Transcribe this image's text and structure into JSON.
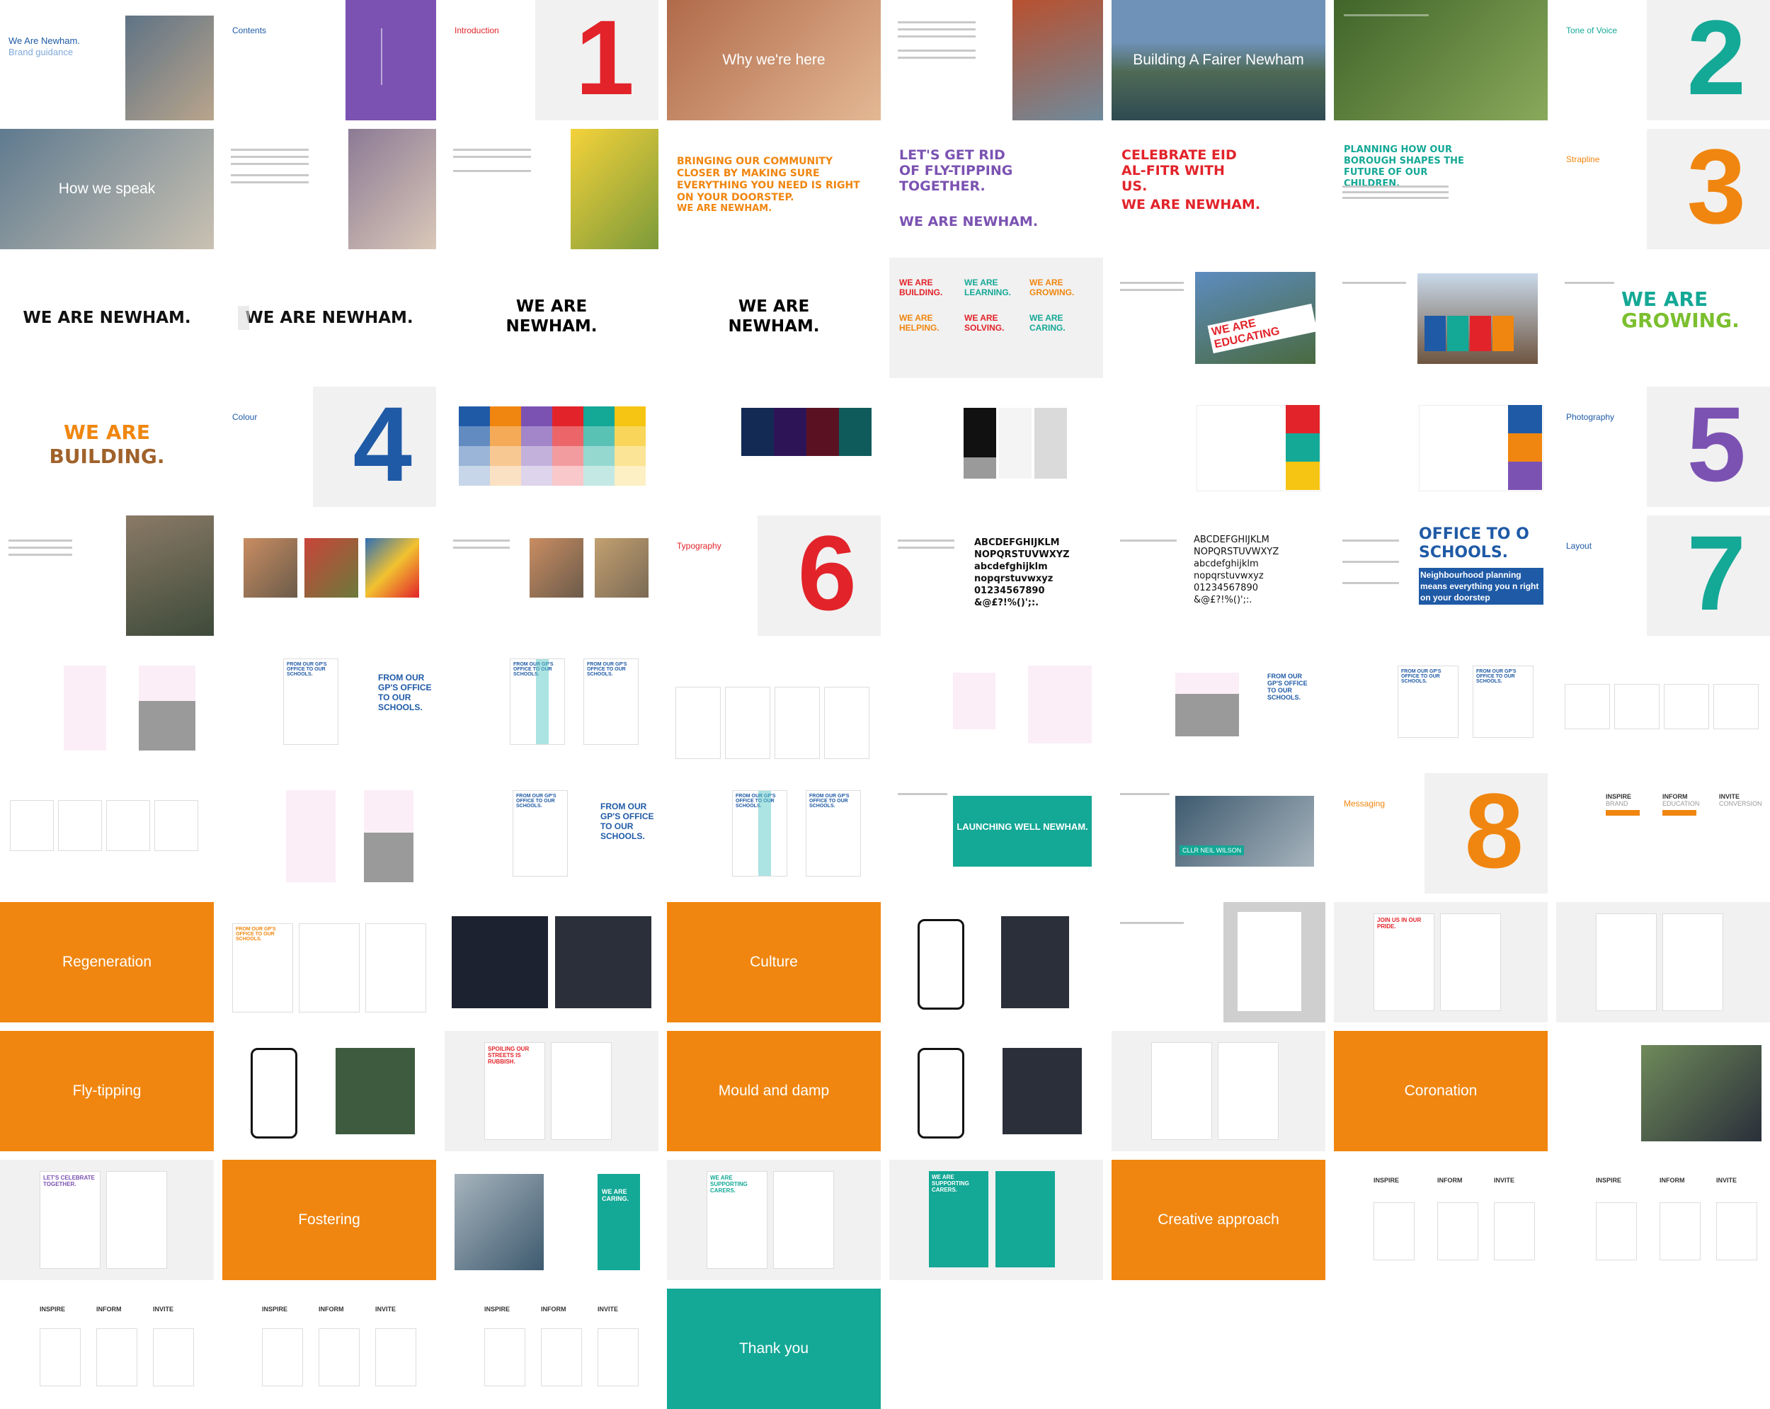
{
  "cover": {
    "title": "We Are Newham.",
    "subtitle": "Brand guidance"
  },
  "contents_label": "Contents",
  "sections": {
    "introduction": "Introduction",
    "tone": "Tone of Voice",
    "strapline": "Strapline",
    "colour": "Colour",
    "photography": "Photography",
    "typography": "Typography",
    "layout": "Layout",
    "messaging": "Messaging"
  },
  "numbers": {
    "n1": "1",
    "n2": "2",
    "n3": "3",
    "n4": "4",
    "n5": "5",
    "n6": "6",
    "n7": "7",
    "n8": "8"
  },
  "photo_titles": {
    "why": "Why we're here",
    "fairer": "Building A Fairer Newham",
    "speak": "How we speak"
  },
  "campaigns": {
    "community": "BRINGING OUR COMMUNITY CLOSER BY MAKING SURE EVERYTHING YOU NEED IS RIGHT ON YOUR DOORSTEP.",
    "flytip": "LET'S GET RID OF FLY-TIPPING TOGETHER.",
    "eid": "CELEBRATE EID AL-FITR WITH US.",
    "planning": "PLANNING HOW OUR BOROUGH SHAPES THE FUTURE OF OUR CHILDREN.",
    "wan": "WE ARE NEWHAM.",
    "wan_caps": "WE ARE NEWHAM."
  },
  "strapline": {
    "full": "WE ARE NEWHAM.",
    "stack_line1": "WE ARE",
    "stack_line2": "NEWHAM.",
    "words": [
      "WE ARE BUILDING.",
      "WE ARE LEARNING.",
      "WE ARE GROWING.",
      "WE ARE HELPING.",
      "WE ARE SOLVING.",
      "WE ARE CARING."
    ],
    "growing_1": "WE ARE",
    "growing_2": "GROWING.",
    "building_1": "WE ARE",
    "building_2": "BUILDING.",
    "educating": "WE ARE EDUCATING"
  },
  "type": {
    "upper": "ABCDEFGHIJKLM NOPQRSTUVWXYZ",
    "lower": "abcdefghijklm nopqrstuvwxyz",
    "digits": "01234567890",
    "symbols": "&@£?!%()';:."
  },
  "layout_sample": {
    "headline": "OFFICE TO O SCHOOLS.",
    "sub": "Neighbourhood planning means everything you n right on your doorstep"
  },
  "film": {
    "launch": "LAUNCHING WELL NEWHAM.",
    "caption": "CLLR NEIL WILSON"
  },
  "msg_cols": [
    "INSPIRE",
    "INFORM",
    "INVITE"
  ],
  "msg_sub": [
    "BRAND",
    "EDUCATION",
    "CONVERSION"
  ],
  "themes": {
    "regeneration": "Regeneration",
    "culture": "Culture",
    "flytipping": "Fly-tipping",
    "mould": "Mould and damp",
    "coronation": "Coronation",
    "fostering": "Fostering",
    "creative": "Creative approach",
    "thankyou": "Thank you"
  },
  "poster_heads": {
    "gp": "FROM OUR GP'S OFFICE TO OUR SCHOOLS.",
    "celebrate": "LET'S CELEBRATE TOGETHER.",
    "carers": "WE ARE SUPPORTING CARERS.",
    "caring": "WE ARE CARING.",
    "spoiling": "SPOILING OUR STREETS IS RUBBISH.",
    "proud": "JOIN US IN OUR PRIDE."
  },
  "colors": {
    "orange": "#f0860f",
    "teal": "#14a896",
    "purple": "#7b52b2",
    "red": "#e2232a",
    "blue": "#1f5aa6",
    "yellow": "#f6c413",
    "green": "#7bbf2f"
  }
}
